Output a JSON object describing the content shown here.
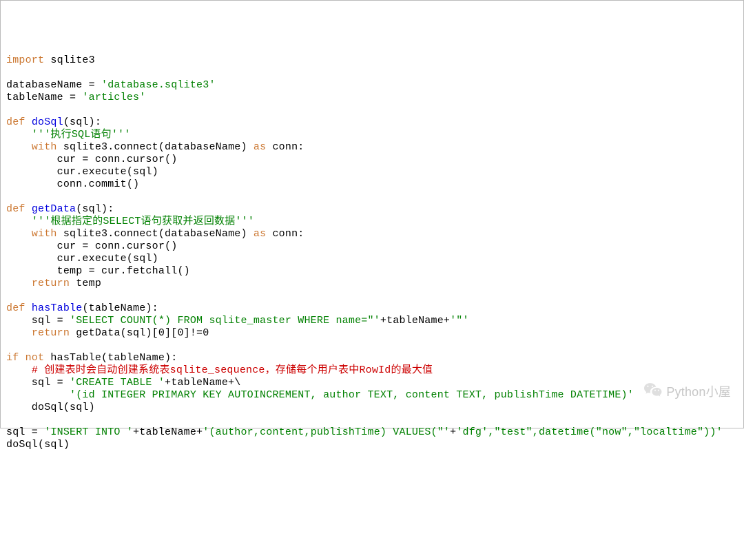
{
  "code": {
    "lines": [
      [
        {
          "t": "import",
          "c": "kw"
        },
        {
          "t": " sqlite3"
        }
      ],
      [
        {
          "t": ""
        }
      ],
      [
        {
          "t": "databaseName = "
        },
        {
          "t": "'database.sqlite3'",
          "c": "str"
        }
      ],
      [
        {
          "t": "tableName = "
        },
        {
          "t": "'articles'",
          "c": "str"
        }
      ],
      [
        {
          "t": ""
        }
      ],
      [
        {
          "t": "def ",
          "c": "kw"
        },
        {
          "t": "doSql",
          "c": "fn"
        },
        {
          "t": "(sql):"
        }
      ],
      [
        {
          "t": "    "
        },
        {
          "t": "'''执行SQL语句'''",
          "c": "str"
        }
      ],
      [
        {
          "t": "    "
        },
        {
          "t": "with",
          "c": "kw"
        },
        {
          "t": " sqlite3.connect(databaseName) "
        },
        {
          "t": "as",
          "c": "kw"
        },
        {
          "t": " conn:"
        }
      ],
      [
        {
          "t": "        cur = conn.cursor()"
        }
      ],
      [
        {
          "t": "        cur.execute(sql)"
        }
      ],
      [
        {
          "t": "        conn.commit()"
        }
      ],
      [
        {
          "t": ""
        }
      ],
      [
        {
          "t": "def ",
          "c": "kw"
        },
        {
          "t": "getData",
          "c": "fn"
        },
        {
          "t": "(sql):"
        }
      ],
      [
        {
          "t": "    "
        },
        {
          "t": "'''根据指定的SELECT语句获取并返回数据'''",
          "c": "str"
        }
      ],
      [
        {
          "t": "    "
        },
        {
          "t": "with",
          "c": "kw"
        },
        {
          "t": " sqlite3.connect(databaseName) "
        },
        {
          "t": "as",
          "c": "kw"
        },
        {
          "t": " conn:"
        }
      ],
      [
        {
          "t": "        cur = conn.cursor()"
        }
      ],
      [
        {
          "t": "        cur.execute(sql)"
        }
      ],
      [
        {
          "t": "        temp = cur.fetchall()"
        }
      ],
      [
        {
          "t": "    "
        },
        {
          "t": "return",
          "c": "kw"
        },
        {
          "t": " temp"
        }
      ],
      [
        {
          "t": ""
        }
      ],
      [
        {
          "t": "def ",
          "c": "kw"
        },
        {
          "t": "hasTable",
          "c": "fn"
        },
        {
          "t": "(tableName):"
        }
      ],
      [
        {
          "t": "    sql = "
        },
        {
          "t": "'SELECT COUNT(*) FROM sqlite_master WHERE name=\"'",
          "c": "str"
        },
        {
          "t": "+tableName+"
        },
        {
          "t": "'\"'",
          "c": "str"
        }
      ],
      [
        {
          "t": "    "
        },
        {
          "t": "return",
          "c": "kw"
        },
        {
          "t": " getData(sql)[0][0]!=0"
        }
      ],
      [
        {
          "t": ""
        }
      ],
      [
        {
          "t": "if not",
          "c": "kw"
        },
        {
          "t": " hasTable(tableName):"
        }
      ],
      [
        {
          "t": "    "
        },
        {
          "t": "# 创建表时会自动创建系统表sqlite_sequence，存储每个用户表中RowId的最大值",
          "c": "cmt"
        }
      ],
      [
        {
          "t": "    sql = "
        },
        {
          "t": "'CREATE TABLE '",
          "c": "str"
        },
        {
          "t": "+tableName+\\"
        }
      ],
      [
        {
          "t": "          "
        },
        {
          "t": "'(id INTEGER PRIMARY KEY AUTOINCREMENT, author TEXT, content TEXT, publishTime DATETIME)'",
          "c": "str"
        }
      ],
      [
        {
          "t": "    doSql(sql)"
        }
      ],
      [
        {
          "t": ""
        }
      ],
      [
        {
          "t": "sql = "
        },
        {
          "t": "'INSERT INTO '",
          "c": "str"
        },
        {
          "t": "+tableName+"
        },
        {
          "t": "'(author,content,publishTime) VALUES(\"'",
          "c": "str"
        },
        {
          "t": "+"
        },
        {
          "t": "'dfg',\"test\",datetime(\"now\",\"localtime\"))'",
          "c": "str"
        }
      ],
      [
        {
          "t": "doSql(sql)"
        }
      ]
    ]
  },
  "watermark": "Python小屋"
}
